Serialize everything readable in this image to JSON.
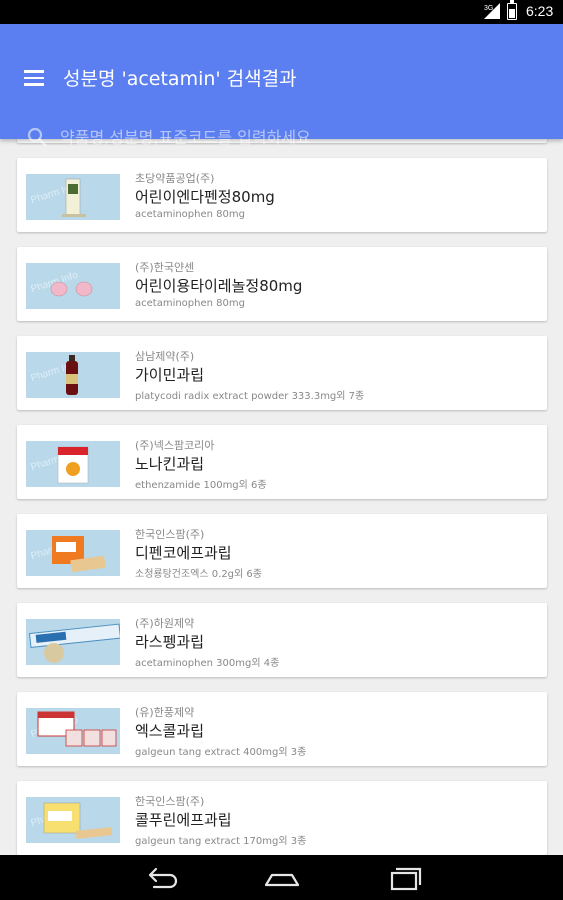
{
  "status_bar": {
    "signal_label": "3G",
    "time": "6:23"
  },
  "app_bar": {
    "title": "성분명 'acetamin' 검색결과",
    "search_placeholder": "약품명,성분명,표준코드를 입력하세요"
  },
  "results": [
    {
      "company": "초당약품공업(주)",
      "name": "어린이엔다펜정80mg",
      "ingredient": "acetaminophen 80mg"
    },
    {
      "company": "(주)한국얀센",
      "name": "어린이용타이레놀정80mg",
      "ingredient": "acetaminophen 80mg"
    },
    {
      "company": "삼남제약(주)",
      "name": "가이민과립",
      "ingredient": "platycodi radix extract powder 333.3mg외 7종"
    },
    {
      "company": "(주)넥스팜코리아",
      "name": "노나킨과립",
      "ingredient": "ethenzamide 100mg외 6종"
    },
    {
      "company": "한국인스팜(주)",
      "name": "디펜코에프과립",
      "ingredient": "소청룡탕건조엑스 0.2g외 6종"
    },
    {
      "company": "(주)하원제약",
      "name": "라스펭과립",
      "ingredient": "acetaminophen 300mg외 4종"
    },
    {
      "company": "(유)한풍제약",
      "name": "엑스콜과립",
      "ingredient": "galgeun tang extract 400mg외 3종"
    },
    {
      "company": "한국인스팜(주)",
      "name": "콜푸린에프과립",
      "ingredient": "galgeun tang extract 170mg외 3종"
    }
  ],
  "thumb_watermark": "Pharm Info",
  "colors": {
    "app_bar": "#5b7ff0",
    "thumb_bg": "#b9d8ea",
    "list_bg": "#efefef"
  },
  "icons": {
    "menu": "hamburger-menu-icon",
    "search": "search-icon",
    "back": "back-icon",
    "home": "home-icon",
    "recent": "recent-apps-icon"
  }
}
